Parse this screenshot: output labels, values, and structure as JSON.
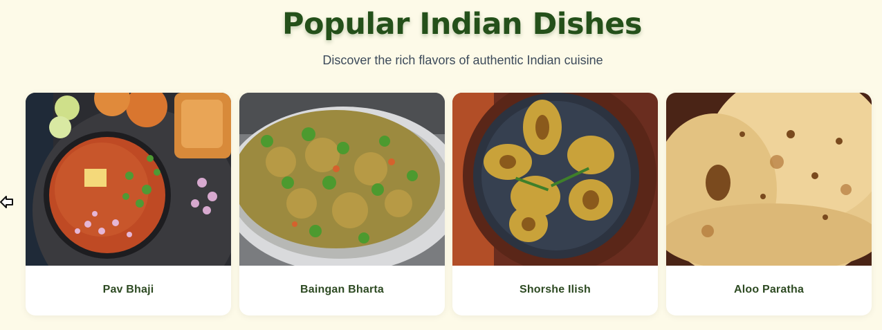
{
  "section": {
    "title": "Popular Indian Dishes",
    "subtitle": "Discover the rich flavors of authentic Indian cuisine"
  },
  "carousel": {
    "prev_icon": "arrow-left-icon",
    "dishes": [
      {
        "name": "Pav Bhaji"
      },
      {
        "name": "Baingan Bharta"
      },
      {
        "name": "Shorshe Ilish"
      },
      {
        "name": "Aloo Paratha"
      }
    ]
  },
  "colors": {
    "background": "#fdfae8",
    "title": "#24501a",
    "card_text": "#2d4a22"
  }
}
